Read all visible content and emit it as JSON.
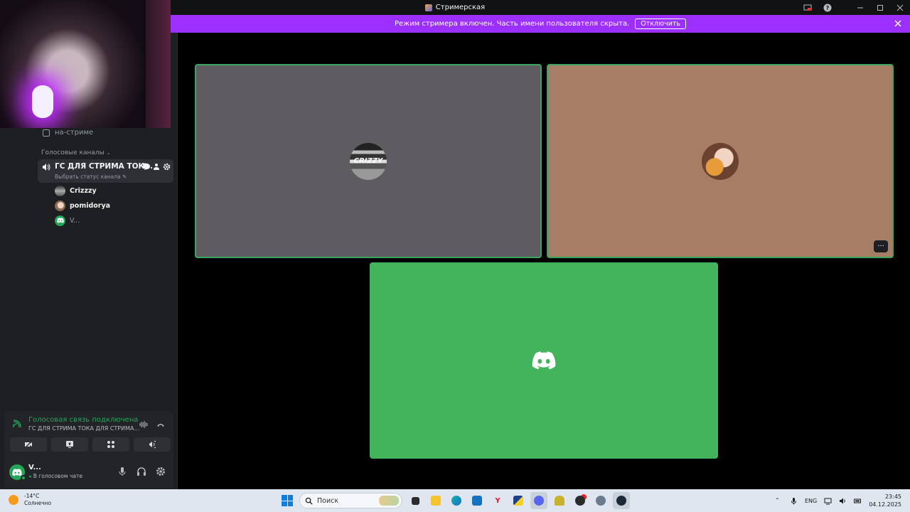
{
  "window": {
    "title": "Стримерская"
  },
  "banner": {
    "text": "Режим стримера включен. Часть имени пользователя скрыта.",
    "button": "Отключить"
  },
  "sidebar": {
    "text_channel": "на-стриме",
    "category": "Голосовые каналы",
    "voice_channel": {
      "name": "ГС ДЛЯ СТРИМА ТОК...",
      "status": "Выбрать статус канала"
    },
    "members": [
      "Crizzzy",
      "pomidorya",
      "V..."
    ]
  },
  "voice_panel": {
    "connected": "Голосовая связь подключена",
    "channel": "ГС ДЛЯ СТРИМА ТОКА ДЛЯ СТРИМА..."
  },
  "user_panel": {
    "name": "V...",
    "status": "В голосовом чате"
  },
  "tiles": {
    "tile1_avatar_text": "CRIZZY"
  },
  "taskbar": {
    "weather_temp": "-14°C",
    "weather_desc": "Солнечно",
    "search_placeholder": "Поиск",
    "lang": "ENG",
    "time": "23:45",
    "date": "04.12.2025"
  },
  "colors": {
    "accent_banner": "#9b30ff",
    "speaking_green": "#3ba55d",
    "discord_green": "#43b45b"
  }
}
